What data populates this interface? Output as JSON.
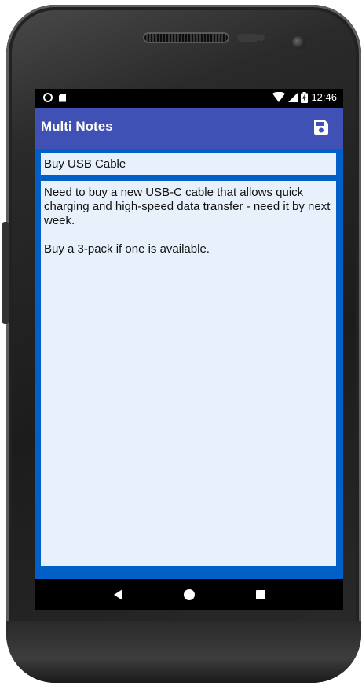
{
  "status_bar": {
    "time": "12:46",
    "icons": [
      "ring-icon",
      "sd-card-icon",
      "wifi-icon",
      "signal-icon",
      "battery-charging-icon"
    ]
  },
  "app_bar": {
    "title": "Multi Notes",
    "save_icon": "save-icon"
  },
  "note": {
    "title": "Buy USB Cable",
    "body": "Need to buy a new USB-C cable that allows quick charging and high-speed data transfer - need it by next week.\n\nBuy a 3-pack if one is available."
  },
  "nav_bar": {
    "icons": [
      "back-icon",
      "home-icon",
      "recents-icon"
    ]
  },
  "colors": {
    "app_bar": "#3f51b5",
    "content_bg": "#0060c8",
    "field_bg": "#e8f0fb",
    "cursor": "#009688"
  }
}
